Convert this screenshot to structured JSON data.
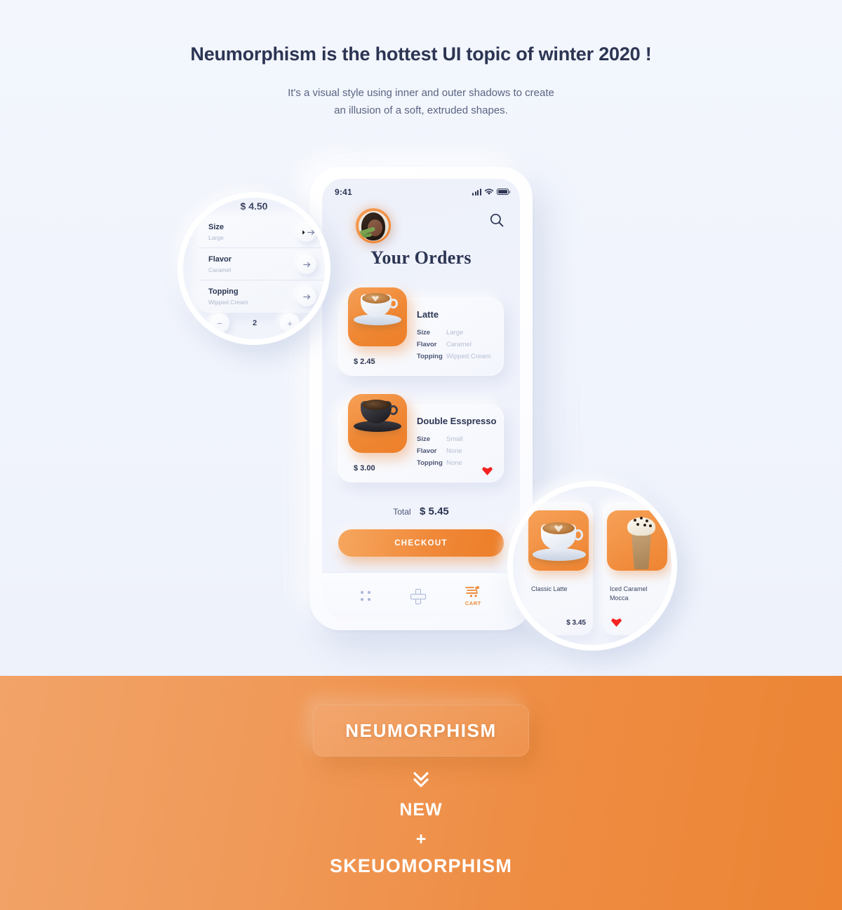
{
  "hero": {
    "title": "Neumorphism is the hottest UI topic of winter 2020 !",
    "subtitle_line1": "It's a visual style using inner and outer shadows to create",
    "subtitle_line2": "an illusion of a soft, extruded shapes."
  },
  "phone": {
    "statusbar": {
      "time": "9:41",
      "signal_icon": "signal-bars-icon",
      "wifi_icon": "wifi-icon",
      "battery_icon": "battery-icon"
    },
    "avatar_alt": "user-avatar",
    "search_icon": "search-icon",
    "page_title": "Your Orders",
    "orders": [
      {
        "name": "Latte",
        "price": "$ 2.45",
        "attributes": [
          {
            "key": "Size",
            "value": "Large"
          },
          {
            "key": "Flavor",
            "value": "Caramel"
          },
          {
            "key": "Topping",
            "value": "Wipped Cream"
          }
        ],
        "favorite": false
      },
      {
        "name": "Double Esspresso",
        "price": "$ 3.00",
        "attributes": [
          {
            "key": "Size",
            "value": "Small"
          },
          {
            "key": "Flavor",
            "value": "None"
          },
          {
            "key": "Topping",
            "value": "None"
          }
        ],
        "favorite": true
      }
    ],
    "total_label": "Total",
    "total_value": "$ 5.45",
    "checkout_label": "CHECKOUT",
    "nav": [
      {
        "icon": "grid-dots-icon",
        "label": ""
      },
      {
        "icon": "plus-icon",
        "label": ""
      },
      {
        "icon": "cart-icon",
        "label": "CART"
      }
    ]
  },
  "magnifier_left": {
    "price": "$ 4.50",
    "options": [
      {
        "key": "Size",
        "value": "Large",
        "arrow_icon": "arrow-right-icon"
      },
      {
        "key": "Flavor",
        "value": "Caramel",
        "arrow_icon": "arrow-right-icon"
      },
      {
        "key": "Topping",
        "value": "Wipped Cream",
        "arrow_icon": "arrow-right-icon"
      }
    ],
    "stepper": {
      "minus": "−",
      "quantity": "2",
      "plus": "+"
    }
  },
  "magnifier_right": {
    "products": [
      {
        "name": "Classic Latte",
        "price": "$ 3.45",
        "favorite": false
      },
      {
        "name": "Iced Caramel Mocca",
        "price": "$",
        "favorite": true
      }
    ]
  },
  "orange_section": {
    "button_label": "NEUMORPHISM",
    "chevron_icon": "chevron-double-down-icon",
    "line_new": "NEW",
    "line_plus": "+",
    "line_skeuomorphism": "SKEUOMORPHISM"
  },
  "colors": {
    "page_bg": "#f2f5fd",
    "accent_orange": "#ef8734",
    "orange_light": "#f2a368",
    "text_dark": "#2c3553",
    "text_muted": "#b8bfd2",
    "heart_red": "#f52222"
  }
}
